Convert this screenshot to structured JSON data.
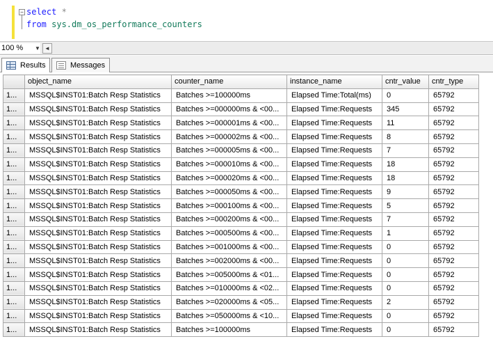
{
  "editor": {
    "fold_symbol": "−",
    "line1_keyword": "select",
    "line1_rest": " *",
    "line2_keyword": "from",
    "line2_rest": " sys.dm_os_performance_counters"
  },
  "zoom": {
    "value": "100 %",
    "dropdown_arrow": "▼",
    "scroll_left": "◄"
  },
  "tabs": [
    {
      "label": "Results",
      "active": true
    },
    {
      "label": "Messages",
      "active": false
    }
  ],
  "grid": {
    "columns": [
      "object_name",
      "counter_name",
      "instance_name",
      "cntr_value",
      "cntr_type"
    ],
    "rows": [
      {
        "n": "1...",
        "c": [
          "MSSQL$INST01:Batch Resp Statistics",
          "Batches >=100000ms",
          "Elapsed Time:Total(ms)",
          "0",
          "65792"
        ]
      },
      {
        "n": "1...",
        "c": [
          "MSSQL$INST01:Batch Resp Statistics",
          "Batches >=000000ms & <00...",
          "Elapsed Time:Requests",
          "345",
          "65792"
        ]
      },
      {
        "n": "1...",
        "c": [
          "MSSQL$INST01:Batch Resp Statistics",
          "Batches >=000001ms & <00...",
          "Elapsed Time:Requests",
          "11",
          "65792"
        ]
      },
      {
        "n": "1...",
        "c": [
          "MSSQL$INST01:Batch Resp Statistics",
          "Batches >=000002ms & <00...",
          "Elapsed Time:Requests",
          "8",
          "65792"
        ]
      },
      {
        "n": "1...",
        "c": [
          "MSSQL$INST01:Batch Resp Statistics",
          "Batches >=000005ms & <00...",
          "Elapsed Time:Requests",
          "7",
          "65792"
        ]
      },
      {
        "n": "1...",
        "c": [
          "MSSQL$INST01:Batch Resp Statistics",
          "Batches >=000010ms & <00...",
          "Elapsed Time:Requests",
          "18",
          "65792"
        ]
      },
      {
        "n": "1...",
        "c": [
          "MSSQL$INST01:Batch Resp Statistics",
          "Batches >=000020ms & <00...",
          "Elapsed Time:Requests",
          "18",
          "65792"
        ]
      },
      {
        "n": "1...",
        "c": [
          "MSSQL$INST01:Batch Resp Statistics",
          "Batches >=000050ms & <00...",
          "Elapsed Time:Requests",
          "9",
          "65792"
        ]
      },
      {
        "n": "1...",
        "c": [
          "MSSQL$INST01:Batch Resp Statistics",
          "Batches >=000100ms & <00...",
          "Elapsed Time:Requests",
          "5",
          "65792"
        ]
      },
      {
        "n": "1...",
        "c": [
          "MSSQL$INST01:Batch Resp Statistics",
          "Batches >=000200ms & <00...",
          "Elapsed Time:Requests",
          "7",
          "65792"
        ]
      },
      {
        "n": "1...",
        "c": [
          "MSSQL$INST01:Batch Resp Statistics",
          "Batches >=000500ms & <00...",
          "Elapsed Time:Requests",
          "1",
          "65792"
        ]
      },
      {
        "n": "1...",
        "c": [
          "MSSQL$INST01:Batch Resp Statistics",
          "Batches >=001000ms & <00...",
          "Elapsed Time:Requests",
          "0",
          "65792"
        ]
      },
      {
        "n": "1...",
        "c": [
          "MSSQL$INST01:Batch Resp Statistics",
          "Batches >=002000ms & <00...",
          "Elapsed Time:Requests",
          "0",
          "65792"
        ]
      },
      {
        "n": "1...",
        "c": [
          "MSSQL$INST01:Batch Resp Statistics",
          "Batches >=005000ms & <01...",
          "Elapsed Time:Requests",
          "0",
          "65792"
        ]
      },
      {
        "n": "1...",
        "c": [
          "MSSQL$INST01:Batch Resp Statistics",
          "Batches >=010000ms & <02...",
          "Elapsed Time:Requests",
          "0",
          "65792"
        ]
      },
      {
        "n": "1...",
        "c": [
          "MSSQL$INST01:Batch Resp Statistics",
          "Batches >=020000ms & <05...",
          "Elapsed Time:Requests",
          "2",
          "65792"
        ]
      },
      {
        "n": "1...",
        "c": [
          "MSSQL$INST01:Batch Resp Statistics",
          "Batches >=050000ms & <10...",
          "Elapsed Time:Requests",
          "0",
          "65792"
        ]
      },
      {
        "n": "1...",
        "c": [
          "MSSQL$INST01:Batch Resp Statistics",
          "Batches >=100000ms",
          "Elapsed Time:Requests",
          "0",
          "65792"
        ]
      }
    ]
  }
}
